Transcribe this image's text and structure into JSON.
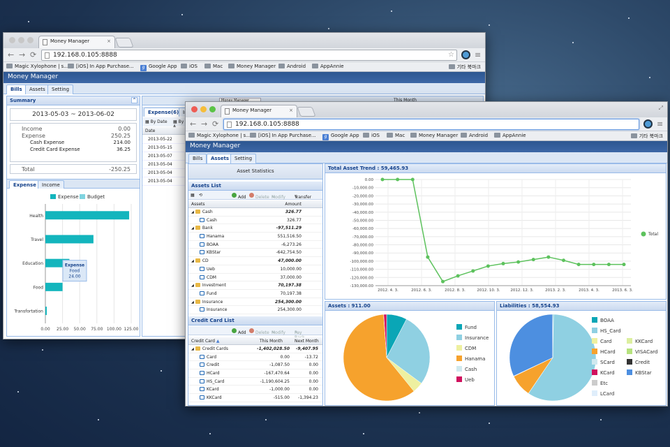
{
  "desktop": {
    "stars": [
      [
        40,
        30
      ],
      [
        120,
        70
      ],
      [
        260,
        20
      ],
      [
        330,
        90
      ],
      [
        470,
        40
      ],
      [
        560,
        15
      ],
      [
        640,
        95
      ],
      [
        700,
        35
      ],
      [
        820,
        60
      ],
      [
        900,
        25
      ],
      [
        930,
        110
      ],
      [
        870,
        300
      ],
      [
        935,
        420
      ],
      [
        25,
        560
      ],
      [
        140,
        600
      ],
      [
        230,
        530
      ],
      [
        380,
        600
      ],
      [
        520,
        620
      ],
      [
        700,
        605
      ],
      [
        860,
        600
      ],
      [
        60,
        500
      ],
      [
        300,
        620
      ],
      [
        600,
        590
      ],
      [
        915,
        560
      ]
    ]
  },
  "back": {
    "tab_title": "Money Manager",
    "url": "192.168.0.105:8888",
    "bookmarks": [
      "Magic Xylophone | s...",
      "[iOS] In App Purchase...",
      "Google App",
      "iOS",
      "Mac",
      "Money Manager",
      "Android",
      "AppAnnie"
    ],
    "bookmarks_other": "기타 북마크",
    "app_title": "Money Manager",
    "tabs": [
      "Bills",
      "Assets",
      "Setting"
    ],
    "summary": {
      "title": "Summary",
      "range": "2013-05-03  ~  2013-06-02",
      "rows": [
        {
          "l": "Income",
          "v": "0.00"
        },
        {
          "l": "Expense",
          "v": "250.25"
        },
        {
          "l": "Cash Expense",
          "v": "214.00"
        },
        {
          "l": "Credit Card Expense",
          "v": "36.25"
        }
      ],
      "total_label": "Total",
      "total": "-250.25"
    },
    "chart_tabs": [
      "Expense",
      "Income"
    ],
    "legend": [
      "Expense",
      "Budget"
    ],
    "bar_chart": {
      "categories": [
        "Health",
        "Travel",
        "Education",
        "Food",
        "Transfortation"
      ],
      "values": [
        122,
        70,
        35,
        25,
        2
      ],
      "xticks": [
        "0.00",
        "25.00",
        "50.00",
        "75.00",
        "100.00",
        "125.00"
      ],
      "xmax": 125
    },
    "tooltip": [
      "Expense",
      "Food",
      "24.00"
    ],
    "expense_tab": "Expense(6)",
    "expense_tab2": "In",
    "by_date": "By Date",
    "by_a": "By A",
    "date_header": "Date",
    "dates": [
      "2013-05-22",
      "2013-05-15",
      "2013-05-07",
      "2013-05-04",
      "2013-05-04",
      "2013-05-04"
    ],
    "month_select": "Money Manager",
    "this_month": "This Month"
  },
  "front": {
    "tab_title": "Money Manager",
    "url": "192.168.0.105:8888",
    "bookmarks": [
      "Magic Xylophone | s...",
      "[iOS] In App Purchase...",
      "Google App",
      "iOS",
      "Mac",
      "Money Manager",
      "Android",
      "AppAnnie"
    ],
    "bookmarks_other": "기타 북마크",
    "app_title": "Money Manager",
    "tabs": [
      "Bills",
      "Assets",
      "Setting"
    ],
    "asset_statistics": "Asset Statistics",
    "assets_list": {
      "title": "Assets List",
      "add": "Add",
      "delete": "Delete",
      "modify": "Modify",
      "transfer": "Transfer",
      "col_assets": "Assets",
      "col_amount": "Amount",
      "rows": [
        {
          "name": "Cash",
          "amount": "326.77",
          "group": true
        },
        {
          "name": "Cash",
          "amount": "326.77",
          "group": false
        },
        {
          "name": "Bank",
          "amount": "-97,511.29",
          "group": true
        },
        {
          "name": "Hanama",
          "amount": "551,516.50",
          "group": false
        },
        {
          "name": "BOAA",
          "amount": "-6,273.26",
          "group": false
        },
        {
          "name": "KBStar",
          "amount": "-642,754.50",
          "group": false
        },
        {
          "name": "CD",
          "amount": "47,000.00",
          "group": true
        },
        {
          "name": "Ueb",
          "amount": "10,000.00",
          "group": false
        },
        {
          "name": "CDM",
          "amount": "37,000.00",
          "group": false
        },
        {
          "name": "Investment",
          "amount": "70,197.38",
          "group": true
        },
        {
          "name": "Fund",
          "amount": "70,197.38",
          "group": false
        },
        {
          "name": "Insurance",
          "amount": "254,300.00",
          "group": true
        },
        {
          "name": "Insurance",
          "amount": "254,300.00",
          "group": false
        }
      ]
    },
    "credit_list": {
      "title": "Credit Card List",
      "add": "Add",
      "delete": "Delete",
      "modify": "Modify",
      "pay_back": "Pay Back",
      "col_card": "Credit Card",
      "col_this": "This Month",
      "col_next": "Next Month",
      "rows": [
        {
          "name": "Credit Cards",
          "this": "-1,402,028.50",
          "next": "-9,407.95",
          "group": true
        },
        {
          "name": "Card",
          "this": "0.00",
          "next": "-13.72",
          "group": false
        },
        {
          "name": "Credit",
          "this": "-1,087.50",
          "next": "0.00",
          "group": false
        },
        {
          "name": "HCard",
          "this": "-167,470.64",
          "next": "0.00",
          "group": false
        },
        {
          "name": "HS_Card",
          "this": "-1,190,604.25",
          "next": "0.00",
          "group": false
        },
        {
          "name": "KCard",
          "this": "-1,000.00",
          "next": "0.00",
          "group": false
        },
        {
          "name": "KKCard",
          "this": "-515.00",
          "next": "-1,394.23",
          "group": false
        }
      ]
    },
    "trend": {
      "title": "Total Asset Trend : 59,465.93",
      "legend": "Total",
      "yticks": [
        "0.00",
        "-10,000.00",
        "-20,000.00",
        "-30,000.00",
        "-40,000.00",
        "-50,000.00",
        "-60,000.00",
        "-70,000.00",
        "-80,000.00",
        "-90,000.00",
        "-100,000.00",
        "-110,000.00",
        "-120,000.00",
        "-130,000.00"
      ],
      "xticks": [
        "2012. 4. 3.",
        "2012. 6. 3.",
        "2012. 8. 3.",
        "2012. 10. 3.",
        "2012. 12. 3.",
        "2013. 2. 3.",
        "2013. 4. 3.",
        "2013. 6. 3."
      ]
    },
    "assets_pie": {
      "title": "Assets : 911.00"
    },
    "liab_pie": {
      "title": "Liabilities : 58,554.93"
    }
  },
  "chart_data": [
    {
      "type": "bar",
      "categories": [
        "Health",
        "Travel",
        "Education",
        "Food",
        "Transfortation"
      ],
      "series": [
        {
          "name": "Expense",
          "values": [
            122,
            70,
            35,
            25,
            2
          ]
        }
      ],
      "xlabel": "",
      "ylabel": "",
      "xlim": [
        0,
        125
      ]
    },
    {
      "type": "line",
      "title": "Total Asset Trend : 59,465.93",
      "series": [
        {
          "name": "Total",
          "values": [
            0,
            0,
            0,
            -95000,
            -125000,
            -118000,
            -112000,
            -106000,
            -103000,
            -101000,
            -98000,
            -95000,
            -99000,
            -104000,
            -104000,
            -104000,
            -104000
          ]
        }
      ],
      "ylim": [
        -130000,
        0
      ],
      "xticks": [
        "2012. 4. 3.",
        "2012. 6. 3.",
        "2012. 8. 3.",
        "2012. 10. 3.",
        "2012. 12. 3.",
        "2013. 2. 3.",
        "2013. 4. 3.",
        "2013. 6. 3."
      ],
      "legend": "right"
    },
    {
      "type": "pie",
      "title": "Assets : 911.00",
      "labels": [
        "Fund",
        "Insurance",
        "CDM",
        "Hanama",
        "Cash",
        "Ueb"
      ],
      "values": [
        70197.38,
        254300,
        37000,
        551516.5,
        326.77,
        10000
      ],
      "colors": [
        "#0aa6b6",
        "#8fd0e2",
        "#eef0a0",
        "#f6a22d",
        "#cfe9ef",
        "#d0105e"
      ]
    },
    {
      "type": "pie",
      "title": "Liabilities : 58,554.93",
      "labels": [
        "BOAA",
        "HS_Card",
        "Card",
        "KKCard",
        "HCard",
        "VISACard",
        "SCard",
        "Credit",
        "KCard",
        "KBStar",
        "Etc",
        "LCard"
      ],
      "values": [
        6273.26,
        1190604.25,
        13.72,
        515,
        167470.64,
        500,
        500,
        1087.5,
        1000,
        642754.5,
        500,
        500
      ],
      "colors": [
        "#0aa6b6",
        "#8fd0e2",
        "#eef0a0",
        "#dcef9f",
        "#f6a22d",
        "#b6e27e",
        "#cfe9ef",
        "#333333",
        "#d0105e",
        "#4d8fe0",
        "#cccccc",
        "#dfeefb"
      ]
    }
  ]
}
